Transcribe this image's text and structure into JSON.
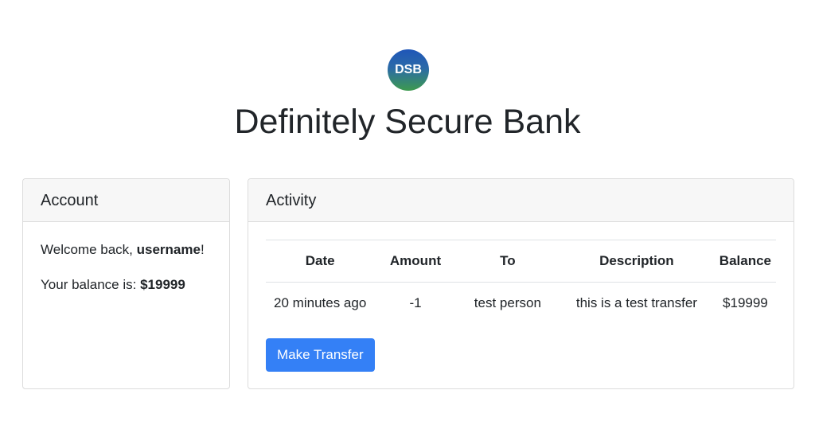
{
  "brand": {
    "logo_text": "DSB",
    "title": "Definitely Secure Bank"
  },
  "account": {
    "header": "Account",
    "welcome_prefix": "Welcome back, ",
    "username": "username",
    "welcome_suffix": "!",
    "balance_label": "Your balance is: ",
    "balance_value": "$19999"
  },
  "activity": {
    "header": "Activity",
    "columns": [
      "Date",
      "Amount",
      "To",
      "Description",
      "Balance"
    ],
    "rows": [
      [
        "20 minutes ago",
        "-1",
        "test person",
        "this is a test transfer",
        "$19999"
      ]
    ],
    "transfer_button": "Make Transfer"
  },
  "colors": {
    "primary_button": "#3480f6",
    "card_header_bg": "#f7f7f7"
  }
}
